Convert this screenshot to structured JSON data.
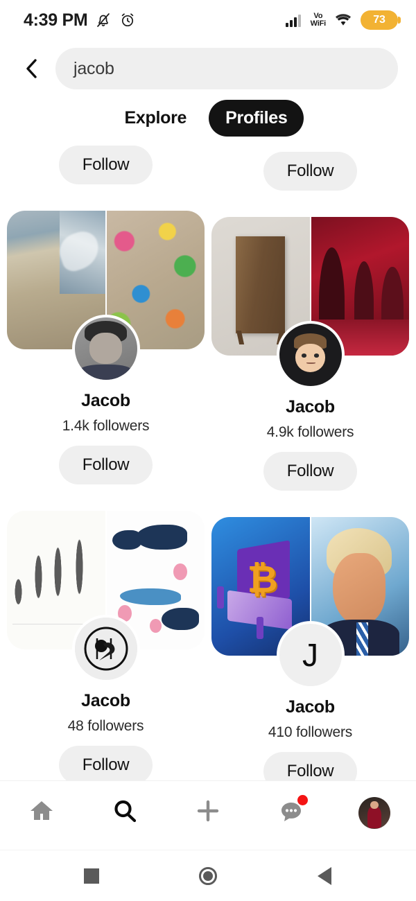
{
  "status_bar": {
    "time": "4:39 PM",
    "mute_icon": "bell-slash-icon",
    "alarm_icon": "alarm-clock-icon",
    "signal_icon": "cellular-signal-icon",
    "vowifi_line1": "Vo",
    "vowifi_line2": "WiFi",
    "wifi_icon": "wifi-icon",
    "battery_level": "73",
    "battery_color": "#f2b233"
  },
  "header": {
    "back_icon": "chevron-left-icon",
    "search_value": "jacob",
    "search_placeholder": "Search"
  },
  "tabs": [
    {
      "label": "Explore",
      "active": false
    },
    {
      "label": "Profiles",
      "active": true
    }
  ],
  "tab_active_bg": "#131313",
  "clipped_row": {
    "left_follow": "Follow",
    "right_follow": "Follow"
  },
  "profiles": [
    {
      "name": "Jacob",
      "followers": "1.4k followers",
      "follow_label": "Follow",
      "avatar_type": "photo-portrait",
      "avatar_initial": "",
      "cover_left": "beach-sand-art-image",
      "cover_right": "colorful-mural-art-image"
    },
    {
      "name": "Jacob",
      "followers": "4.9k followers",
      "follow_label": "Follow",
      "avatar_type": "memoji",
      "avatar_initial": "",
      "cover_left": "wooden-cabinet-image",
      "cover_right": "red-arched-interior-image"
    },
    {
      "name": "Jacob",
      "followers": "48 followers",
      "follow_label": "Follow",
      "avatar_type": "bird-logo",
      "avatar_initial": "",
      "cover_left": "botanical-tree-illustration-image",
      "cover_right": "marine-life-illustration-image"
    },
    {
      "name": "Jacob",
      "followers": "410 followers",
      "follow_label": "Follow",
      "avatar_type": "initial",
      "avatar_initial": "J",
      "cover_left": "bitcoin-laptop-illustration-image",
      "cover_right": "caricature-portrait-image"
    }
  ],
  "bottom_nav": [
    {
      "icon": "home-icon",
      "active": false,
      "badge": false
    },
    {
      "icon": "search-icon",
      "active": true,
      "badge": false
    },
    {
      "icon": "plus-icon",
      "active": false,
      "badge": false
    },
    {
      "icon": "chat-bubble-icon",
      "active": false,
      "badge": true
    },
    {
      "icon": "profile-avatar-icon",
      "active": false,
      "badge": false
    }
  ],
  "badge_color": "#f41414",
  "android_nav": [
    {
      "icon": "recents-square-icon"
    },
    {
      "icon": "home-circle-icon"
    },
    {
      "icon": "back-triangle-icon"
    }
  ]
}
